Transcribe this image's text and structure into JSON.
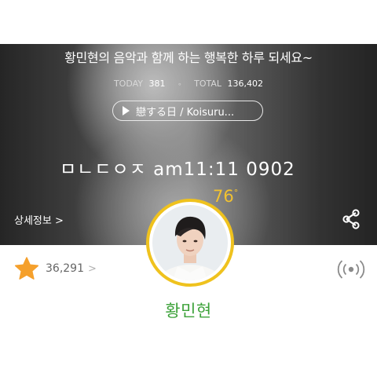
{
  "hero": {
    "greeting": "황민현의 음악과 함께 하는 행복한 하루 되세요~",
    "today_label": "TODAY",
    "today_count": "381",
    "separator": "∘",
    "total_label": "TOTAL",
    "total_count": "136,402",
    "music_title": "戀する日 / Koisuru...",
    "handwriting": "ㅁㄴㄷㅇㅈ am11:11 0902",
    "temperature": "76",
    "degree": "°",
    "detail_label": "상세정보 >",
    "accent_color": "#efc21e"
  },
  "profile": {
    "star_count": "36,291",
    "star_chevron": ">",
    "name": "황민현",
    "name_color": "#3da23a",
    "star_color": "#f5a02c"
  },
  "icons": {
    "share": "share-icon",
    "play": "play-icon",
    "star": "star-icon",
    "radio": "broadcast-icon"
  }
}
